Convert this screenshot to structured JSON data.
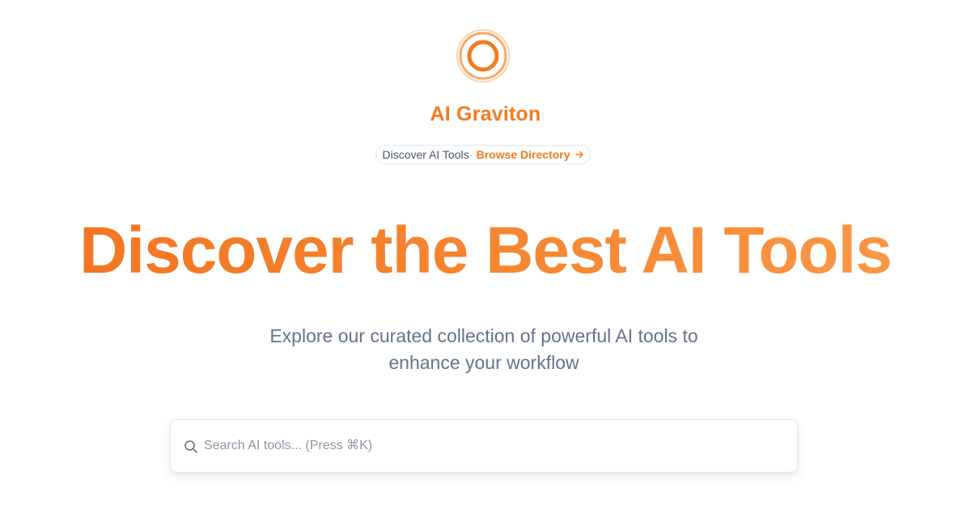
{
  "brand": {
    "logo_icon": "concentric-ring-logo-icon",
    "name": "AI Graviton",
    "accent_color": "#f47a1f"
  },
  "announcement": {
    "text": "Discover AI Tools",
    "link_label": "Browse Directory",
    "link_icon": "arrow-right-icon"
  },
  "hero": {
    "title": "Discover the Best AI Tools",
    "subtitle": "Explore our curated collection of powerful AI tools to enhance your workflow"
  },
  "search": {
    "icon": "search-icon",
    "placeholder": "Search AI tools... (Press ⌘K)",
    "value": ""
  }
}
